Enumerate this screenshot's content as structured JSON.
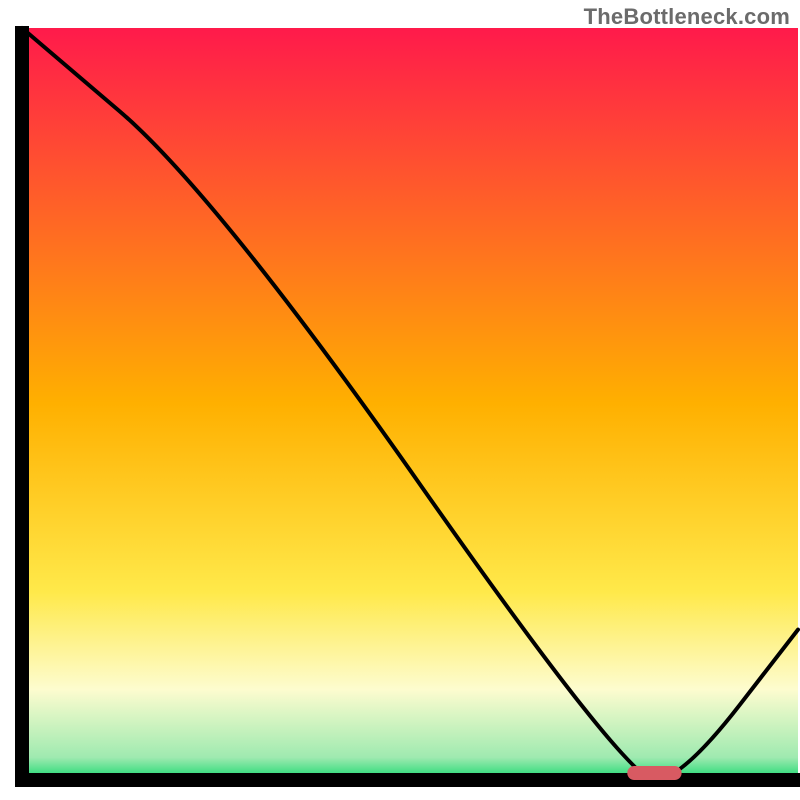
{
  "watermark": "TheBottleneck.com",
  "chart_data": {
    "type": "line",
    "title": "",
    "xlabel": "",
    "ylabel": "",
    "xlim": [
      0,
      100
    ],
    "ylim": [
      0,
      100
    ],
    "grid": false,
    "legend": false,
    "series": [
      {
        "name": "bottleneck-curve",
        "x": [
          0,
          25,
          78,
          85,
          100
        ],
        "values": [
          100,
          78,
          0,
          0,
          20
        ]
      }
    ],
    "marker": {
      "name": "optimal-range",
      "x_start": 78,
      "x_end": 85,
      "y": 0
    },
    "background_gradient": {
      "stops": [
        {
          "offset": 0.0,
          "color": "#ff1a4b"
        },
        {
          "offset": 0.5,
          "color": "#ffb000"
        },
        {
          "offset": 0.75,
          "color": "#ffe94a"
        },
        {
          "offset": 0.88,
          "color": "#fdfccf"
        },
        {
          "offset": 0.97,
          "color": "#9feab0"
        },
        {
          "offset": 1.0,
          "color": "#16d86f"
        }
      ]
    },
    "axes_color": "#000000",
    "line_color": "#000000",
    "marker_color": "#d85a62"
  }
}
